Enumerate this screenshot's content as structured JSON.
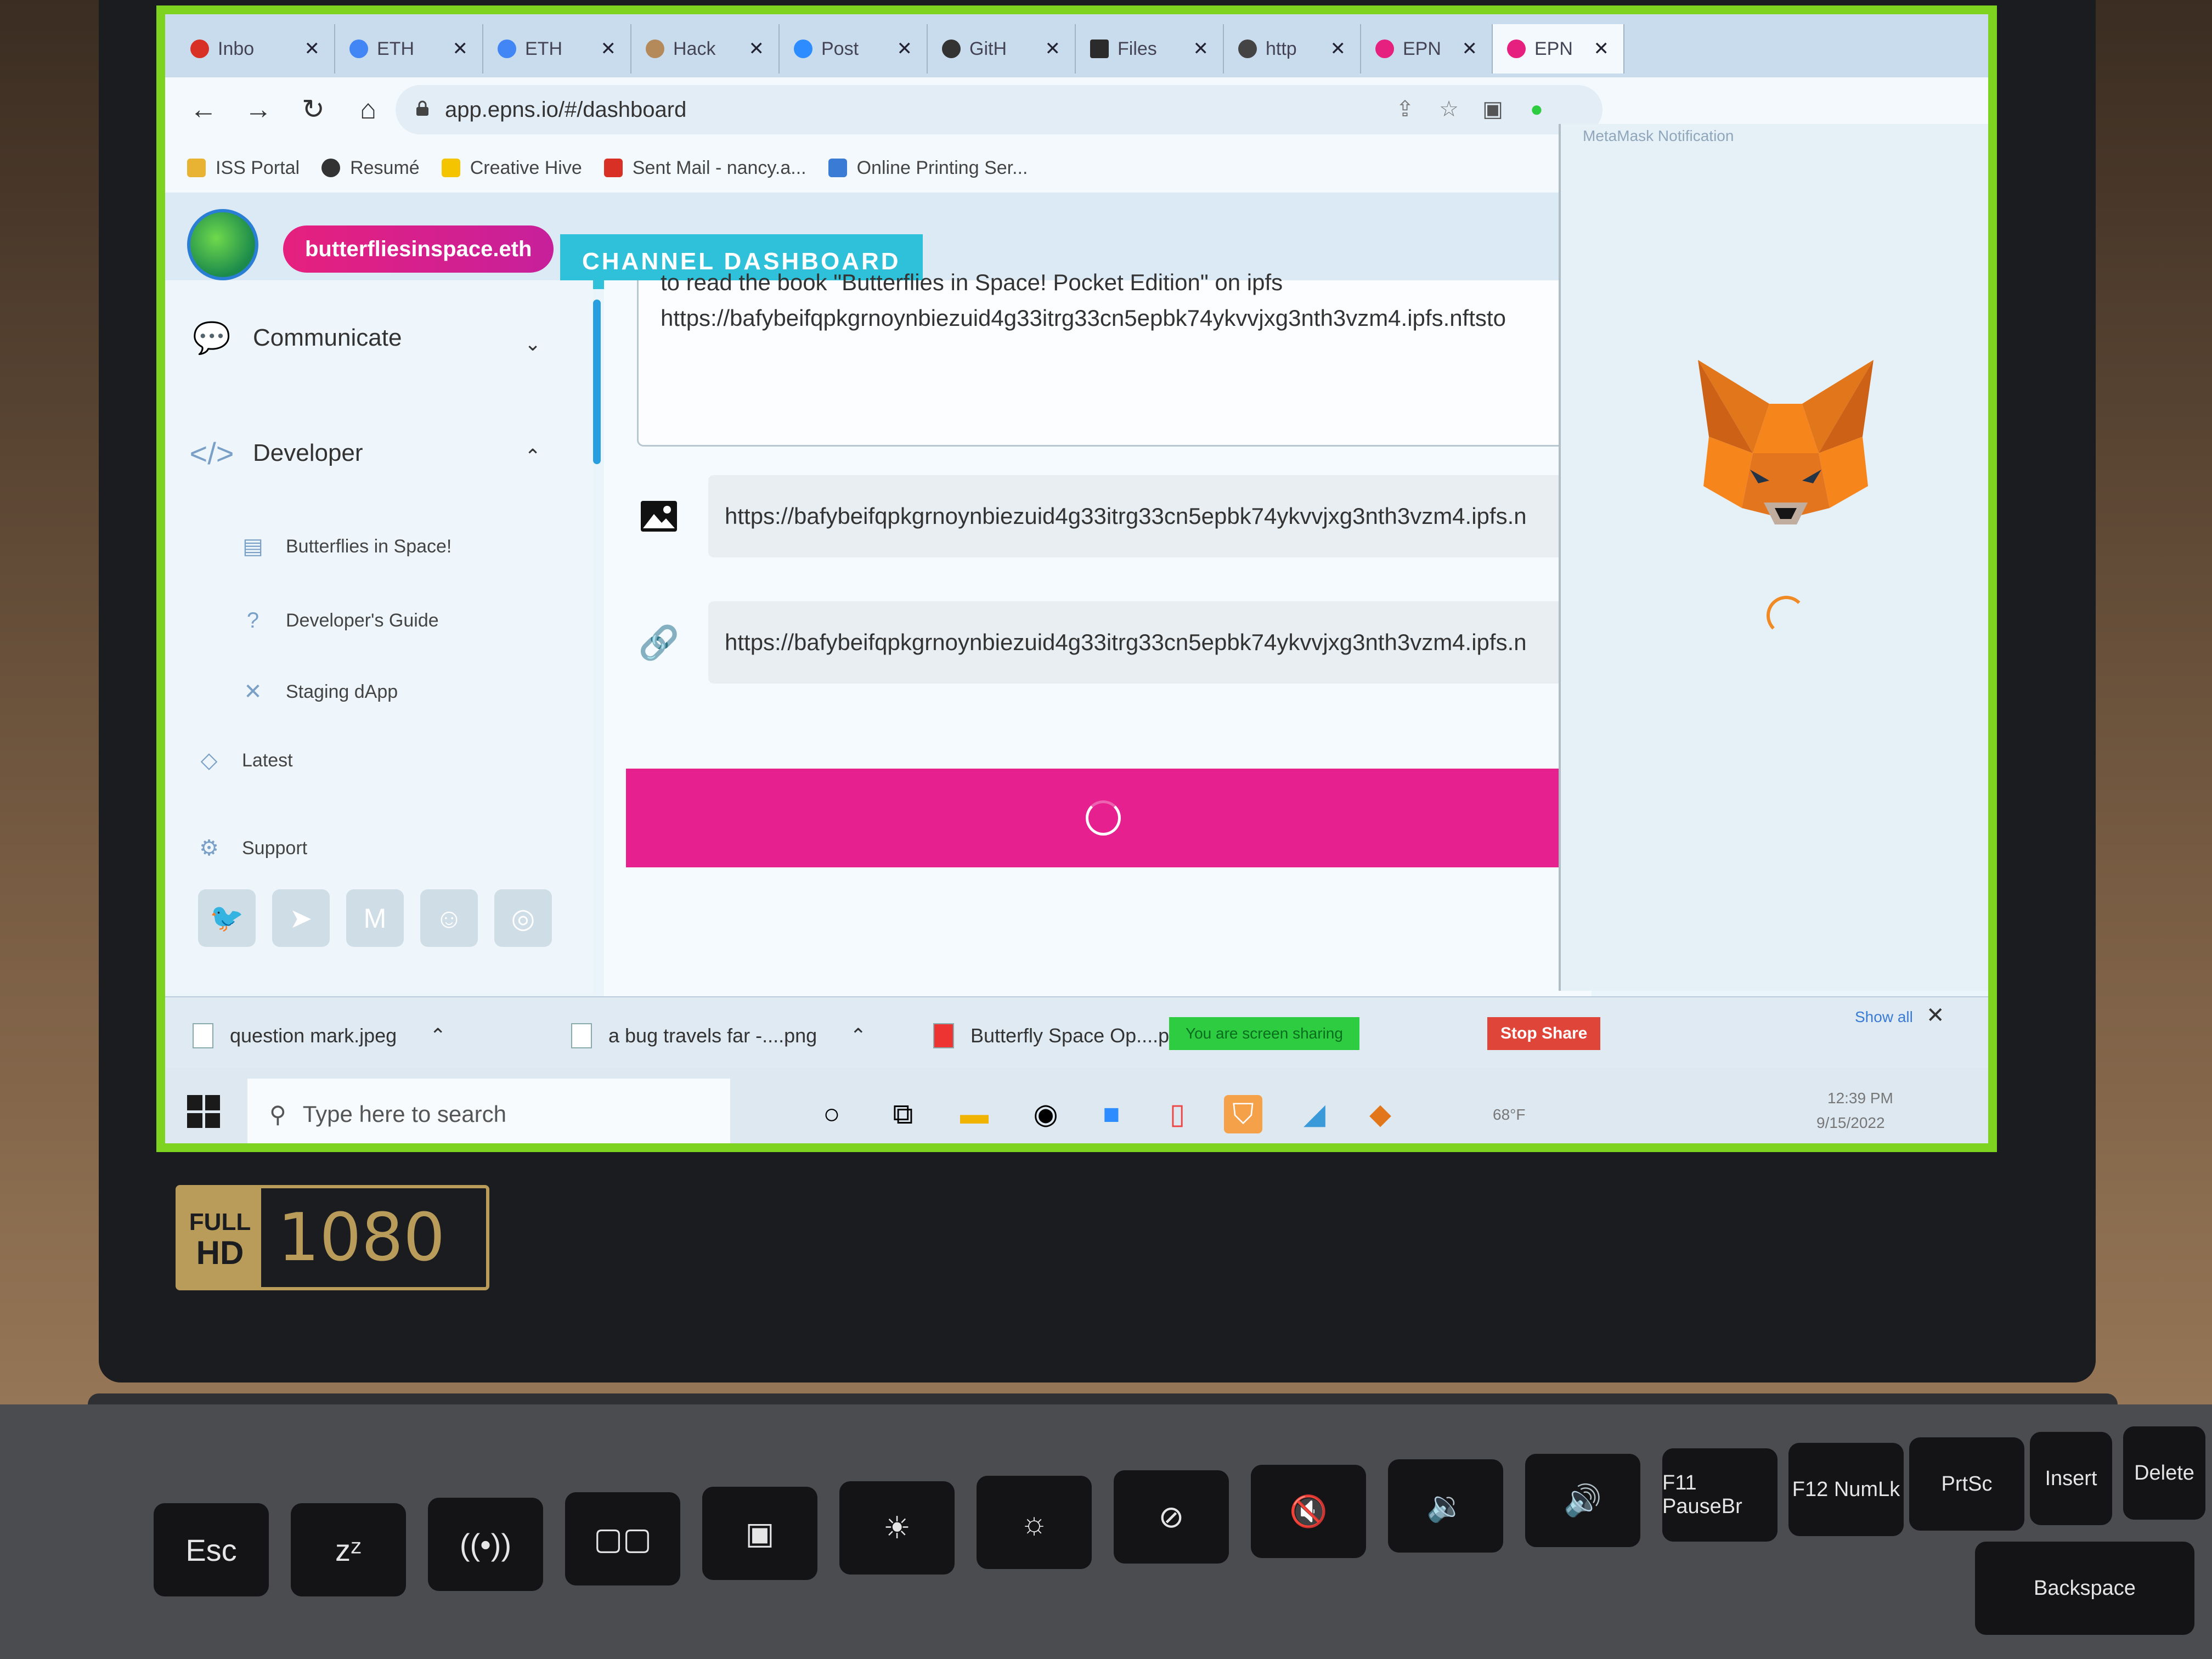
{
  "browser": {
    "tabs": [
      {
        "label": "Inbo",
        "color": "#d93025"
      },
      {
        "label": "ETH",
        "color": "#4285f4"
      },
      {
        "label": "ETH",
        "color": "#4285f4"
      },
      {
        "label": "Hack",
        "color": "#b58a5a"
      },
      {
        "label": "Post",
        "color": "#2d8cff"
      },
      {
        "label": "GitH",
        "color": "#333333"
      },
      {
        "label": "Files",
        "color": "#2b2b2b"
      },
      {
        "label": "http",
        "color": "#444444"
      },
      {
        "label": "EPN",
        "color": "#e6207e"
      },
      {
        "label": "EPN",
        "color": "#e6207e"
      }
    ],
    "url": "app.epns.io/#/dashboard",
    "bookmarks": [
      {
        "label": "ISS Portal"
      },
      {
        "label": "Resumé"
      },
      {
        "label": "Creative Hive"
      },
      {
        "label": "Sent Mail - nancy.a..."
      },
      {
        "label": "Online Printing Ser..."
      }
    ]
  },
  "app": {
    "ens_name": "butterfliesinspace.eth",
    "dashboard_button": "CHANNEL DASHBOARD",
    "sidebar": {
      "communicate": "Communicate",
      "developer": "Developer",
      "sub_items": [
        "Butterflies in Space!",
        "Developer's Guide",
        "Staging dApp"
      ],
      "latest": "Latest",
      "support": "Support"
    },
    "message_lines": [
      "to read the book \"Butterflies in Space! Pocket Edition\" on ipfs",
      "https://bafybeifqpkgrnoynbiezuid4g33itrg33cn5epbk74ykvvjxg3nth3vzm4.ipfs.nftsto"
    ],
    "image_url": "https://bafybeifqpkgrnoynbiezuid4g33itrg33cn5epbk74ykvvjxg3nth3vzm4.ipfs.n",
    "cta_url": "https://bafybeifqpkgrnoynbiezuid4g33itrg33cn5epbk74ykvvjxg3nth3vzm4.ipfs.n",
    "accent_pink": "#e6208f",
    "accent_teal": "#2ec1d9"
  },
  "metamask": {
    "title": "MetaMask Notification"
  },
  "downloads": {
    "items": [
      "question mark.jpeg",
      "a bug travels far -....png",
      "Butterfly Space Op....pdf"
    ],
    "sharing_text": "You are screen sharing",
    "stop_share": "Stop Share",
    "show_all": "Show all"
  },
  "taskbar": {
    "search_placeholder": "Type here to search",
    "temperature": "68°F",
    "time": "12:39 PM",
    "date": "9/15/2022"
  },
  "laptop": {
    "badge_full": "FULL",
    "badge_hd": "HD",
    "badge_res": "1080",
    "keys": [
      "Esc",
      "F11 PauseBr",
      "F12 NumLk",
      "PrtSc",
      "Insert",
      "Delete",
      "Backspace"
    ]
  }
}
